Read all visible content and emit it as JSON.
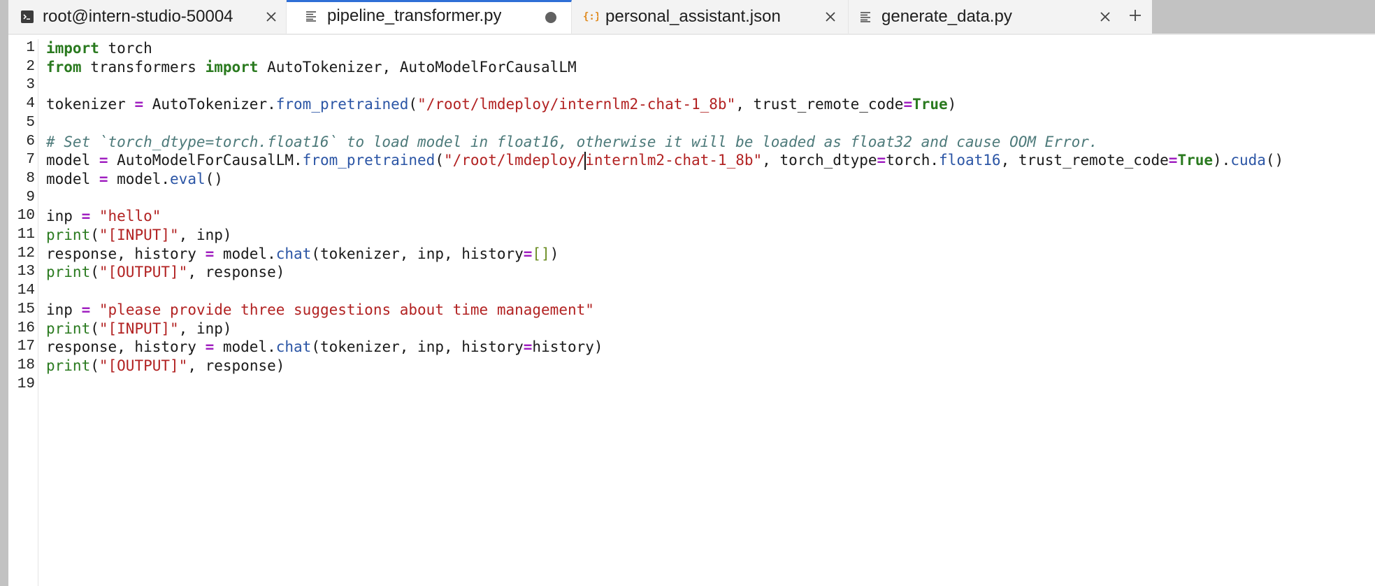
{
  "tabs": [
    {
      "label": "root@intern-studio-50004",
      "icon": "terminal-icon",
      "active": false
    },
    {
      "label": "pipeline_transformer.py",
      "icon": "text-file-icon",
      "active": true,
      "unsaved": true
    },
    {
      "label": "personal_assistant.json",
      "icon": "json-file-icon",
      "active": false
    },
    {
      "label": "generate_data.py",
      "icon": "text-file-icon",
      "active": false
    }
  ],
  "add_tab_icon": "plus-icon",
  "colors": {
    "keyword": "#2a7a1f",
    "operator": "#a020c0",
    "string": "#b22222",
    "function": "#2b55a5",
    "comment": "#4d7a7a",
    "active_tab_accent": "#2f6fd6"
  },
  "editor": {
    "line_numbers": [
      "1",
      "2",
      "3",
      "4",
      "5",
      "6",
      "7",
      "8",
      "9",
      "10",
      "11",
      "12",
      "13",
      "14",
      "15",
      "16",
      "17",
      "18",
      "19"
    ],
    "cursor": {
      "line": 7,
      "after_text": "/root/lmdeploy/"
    },
    "lines": [
      [
        {
          "t": "kw",
          "v": "import"
        },
        {
          "t": "",
          "v": " torch"
        }
      ],
      [
        {
          "t": "kw",
          "v": "from"
        },
        {
          "t": "",
          "v": " transformers "
        },
        {
          "t": "kw",
          "v": "import"
        },
        {
          "t": "",
          "v": " AutoTokenizer, AutoModelForCausalLM"
        }
      ],
      [],
      [
        {
          "t": "",
          "v": "tokenizer "
        },
        {
          "t": "op",
          "v": "="
        },
        {
          "t": "",
          "v": " AutoTokenizer."
        },
        {
          "t": "fn",
          "v": "from_pretrained"
        },
        {
          "t": "",
          "v": "("
        },
        {
          "t": "str",
          "v": "\"/root/lmdeploy/internlm2-chat-1_8b\""
        },
        {
          "t": "",
          "v": ", trust_remote_code"
        },
        {
          "t": "op",
          "v": "="
        },
        {
          "t": "bool",
          "v": "True"
        },
        {
          "t": "",
          "v": ")"
        }
      ],
      [],
      [
        {
          "t": "cmt",
          "v": "# Set `torch_dtype=torch.float16` to load model in float16, otherwise it will be loaded as float32 and cause OOM Error."
        }
      ],
      [
        {
          "t": "",
          "v": "model "
        },
        {
          "t": "op",
          "v": "="
        },
        {
          "t": "",
          "v": " AutoModelForCausalLM."
        },
        {
          "t": "fn",
          "v": "from_pretrained"
        },
        {
          "t": "",
          "v": "("
        },
        {
          "t": "str",
          "v": "\"/root/lmdeploy/"
        },
        {
          "t": "cursor",
          "v": ""
        },
        {
          "t": "str",
          "v": "internlm2-chat-1_8b\""
        },
        {
          "t": "",
          "v": ", torch_dtype"
        },
        {
          "t": "op",
          "v": "="
        },
        {
          "t": "",
          "v": "torch."
        },
        {
          "t": "fn",
          "v": "float16"
        },
        {
          "t": "",
          "v": ", trust_remote_code"
        },
        {
          "t": "op",
          "v": "="
        },
        {
          "t": "bool",
          "v": "True"
        },
        {
          "t": "",
          "v": ")."
        },
        {
          "t": "fn",
          "v": "cuda"
        },
        {
          "t": "",
          "v": "()"
        }
      ],
      [
        {
          "t": "",
          "v": "model "
        },
        {
          "t": "op",
          "v": "="
        },
        {
          "t": "",
          "v": " model."
        },
        {
          "t": "fn",
          "v": "eval"
        },
        {
          "t": "",
          "v": "()"
        }
      ],
      [],
      [
        {
          "t": "",
          "v": "inp "
        },
        {
          "t": "op",
          "v": "="
        },
        {
          "t": "",
          "v": " "
        },
        {
          "t": "str",
          "v": "\"hello\""
        }
      ],
      [
        {
          "t": "builtin",
          "v": "print"
        },
        {
          "t": "",
          "v": "("
        },
        {
          "t": "str",
          "v": "\"[INPUT]\""
        },
        {
          "t": "",
          "v": ", inp)"
        }
      ],
      [
        {
          "t": "",
          "v": "response, history "
        },
        {
          "t": "op",
          "v": "="
        },
        {
          "t": "",
          "v": " model."
        },
        {
          "t": "fn",
          "v": "chat"
        },
        {
          "t": "",
          "v": "(tokenizer, inp, history"
        },
        {
          "t": "op",
          "v": "="
        },
        {
          "t": "lst",
          "v": "[]"
        },
        {
          "t": "",
          "v": ")"
        }
      ],
      [
        {
          "t": "builtin",
          "v": "print"
        },
        {
          "t": "",
          "v": "("
        },
        {
          "t": "str",
          "v": "\"[OUTPUT]\""
        },
        {
          "t": "",
          "v": ", response)"
        }
      ],
      [],
      [
        {
          "t": "",
          "v": "inp "
        },
        {
          "t": "op",
          "v": "="
        },
        {
          "t": "",
          "v": " "
        },
        {
          "t": "str",
          "v": "\"please provide three suggestions about time management\""
        }
      ],
      [
        {
          "t": "builtin",
          "v": "print"
        },
        {
          "t": "",
          "v": "("
        },
        {
          "t": "str",
          "v": "\"[INPUT]\""
        },
        {
          "t": "",
          "v": ", inp)"
        }
      ],
      [
        {
          "t": "",
          "v": "response, history "
        },
        {
          "t": "op",
          "v": "="
        },
        {
          "t": "",
          "v": " model."
        },
        {
          "t": "fn",
          "v": "chat"
        },
        {
          "t": "",
          "v": "(tokenizer, inp, history"
        },
        {
          "t": "op",
          "v": "="
        },
        {
          "t": "",
          "v": "history)"
        }
      ],
      [
        {
          "t": "builtin",
          "v": "print"
        },
        {
          "t": "",
          "v": "("
        },
        {
          "t": "str",
          "v": "\"[OUTPUT]\""
        },
        {
          "t": "",
          "v": ", response)"
        }
      ],
      []
    ]
  }
}
